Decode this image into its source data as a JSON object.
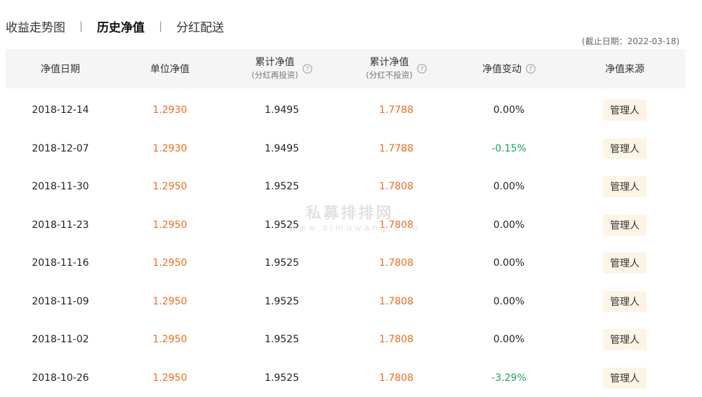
{
  "tabs": [
    {
      "label": "收益走势图",
      "active": false
    },
    {
      "label": "历史净值",
      "active": true
    },
    {
      "label": "分红配送",
      "active": false
    }
  ],
  "tab_separator": "|",
  "cutoff_text": "(截止日期：2022-03-18)",
  "header": {
    "date": "净值日期",
    "unit_nav": "单位净值",
    "acc_nav_reinvest": "累计净值",
    "acc_nav_reinvest_sub": "(分红再投资)",
    "acc_nav_noreinvest": "累计净值",
    "acc_nav_noreinvest_sub": "(分红不投资)",
    "nav_change": "净值变动",
    "nav_source": "净值来源"
  },
  "rows": [
    {
      "date": "2018-12-14",
      "unit_nav": "1.2930",
      "acc_reinvest": "1.9495",
      "acc_noreinvest": "1.7788",
      "change": "0.00%",
      "change_dir": "flat",
      "source": "管理人"
    },
    {
      "date": "2018-12-07",
      "unit_nav": "1.2930",
      "acc_reinvest": "1.9495",
      "acc_noreinvest": "1.7788",
      "change": "-0.15%",
      "change_dir": "down",
      "source": "管理人"
    },
    {
      "date": "2018-11-30",
      "unit_nav": "1.2950",
      "acc_reinvest": "1.9525",
      "acc_noreinvest": "1.7808",
      "change": "0.00%",
      "change_dir": "flat",
      "source": "管理人"
    },
    {
      "date": "2018-11-23",
      "unit_nav": "1.2950",
      "acc_reinvest": "1.9525",
      "acc_noreinvest": "1.7808",
      "change": "0.00%",
      "change_dir": "flat",
      "source": "管理人"
    },
    {
      "date": "2018-11-16",
      "unit_nav": "1.2950",
      "acc_reinvest": "1.9525",
      "acc_noreinvest": "1.7808",
      "change": "0.00%",
      "change_dir": "flat",
      "source": "管理人"
    },
    {
      "date": "2018-11-09",
      "unit_nav": "1.2950",
      "acc_reinvest": "1.9525",
      "acc_noreinvest": "1.7808",
      "change": "0.00%",
      "change_dir": "flat",
      "source": "管理人"
    },
    {
      "date": "2018-11-02",
      "unit_nav": "1.2950",
      "acc_reinvest": "1.9525",
      "acc_noreinvest": "1.7808",
      "change": "0.00%",
      "change_dir": "flat",
      "source": "管理人"
    },
    {
      "date": "2018-10-26",
      "unit_nav": "1.2950",
      "acc_reinvest": "1.9525",
      "acc_noreinvest": "1.7808",
      "change": "-3.29%",
      "change_dir": "down",
      "source": "管理人"
    }
  ],
  "watermark": {
    "main": "私募排排网",
    "sub": "www.simuwang.com"
  },
  "colors": {
    "accent_orange": "#f26b1d",
    "negative_green": "#1fa35a",
    "badge_bg": "#fdf4e6",
    "header_bg": "#f5f5f5"
  }
}
